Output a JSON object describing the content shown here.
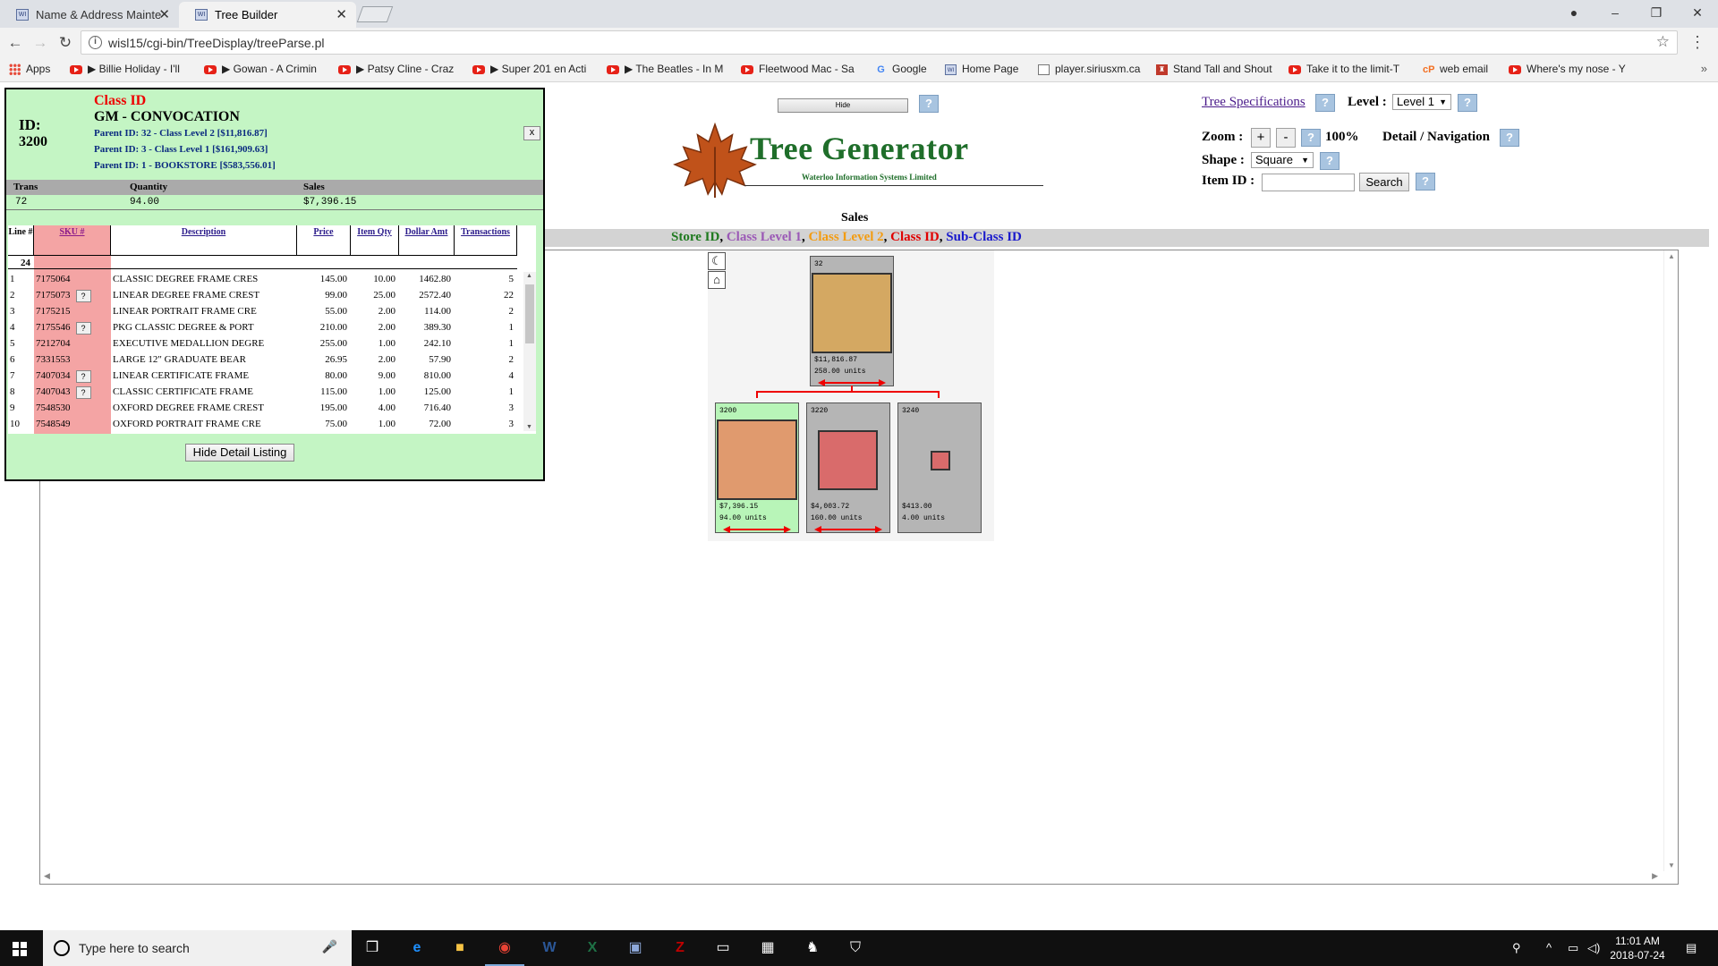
{
  "browser": {
    "tabs": [
      {
        "label": "Name & Address Mainte",
        "active": false
      },
      {
        "label": "Tree Builder",
        "active": true
      }
    ],
    "url": "wisl15/cgi-bin/TreeDisplay/treeParse.pl",
    "bookmarks": [
      {
        "label": "Apps",
        "icon": "apps-grid-icon"
      },
      {
        "label": "▶ Billie Holiday - I'll",
        "icon": "youtube-icon"
      },
      {
        "label": "▶ Gowan - A Crimin",
        "icon": "youtube-icon"
      },
      {
        "label": "▶ Patsy Cline - Craz",
        "icon": "youtube-icon"
      },
      {
        "label": "▶ Super 201 en Acti",
        "icon": "youtube-icon"
      },
      {
        "label": "▶ The Beatles - In M",
        "icon": "youtube-icon"
      },
      {
        "label": "Fleetwood Mac - Sa",
        "icon": "youtube-icon"
      },
      {
        "label": "Google",
        "icon": "google-icon"
      },
      {
        "label": "Home Page",
        "icon": "wisl-icon"
      },
      {
        "label": "player.siriusxm.ca",
        "icon": "page-icon"
      },
      {
        "label": "Stand Tall and Shout",
        "icon": "bookmark-icon"
      },
      {
        "label": "Take it to the limit-T",
        "icon": "youtube-icon"
      },
      {
        "label": "web email",
        "icon": "cpanel-icon"
      },
      {
        "label": "Where's my nose - Y",
        "icon": "youtube-icon"
      }
    ],
    "more": "»"
  },
  "controls": {
    "hide_label": "Hide",
    "help_label": "?",
    "tree_spec_link": "Tree Specifications",
    "level_label": "Level :",
    "level_value": "Level 1",
    "zoom_label": "Zoom :",
    "zoom_plus": "+",
    "zoom_minus": "-",
    "zoom_value": "100%",
    "detail_nav_label": "Detail / Navigation",
    "shape_label": "Shape :",
    "shape_value": "Square",
    "item_id_label": "Item ID :",
    "item_id_value": "",
    "search_label": "Search"
  },
  "logo": {
    "title": "Tree Generator",
    "subtitle": "Waterloo Information Systems Limited"
  },
  "sales_label": "Sales",
  "legend": [
    {
      "text": "Store ID",
      "color": "#1f7a1f"
    },
    {
      "text": ", ",
      "color": "#000000"
    },
    {
      "text": "Class Level 1",
      "color": "#9b59b6"
    },
    {
      "text": ", ",
      "color": "#000000"
    },
    {
      "text": "Class Level 2",
      "color": "#f39c12"
    },
    {
      "text": ", ",
      "color": "#000000"
    },
    {
      "text": "Class ID",
      "color": "#e00000"
    },
    {
      "text": ", ",
      "color": "#000000"
    },
    {
      "text": "Sub-Class ID",
      "color": "#1a1acc"
    }
  ],
  "tree": {
    "tools": [
      "☾",
      "⌂"
    ],
    "root": {
      "id": "32",
      "amount": "$11,816.87",
      "units": "258.00 units",
      "fill": "#d4a862",
      "relative_size": 1.0
    },
    "children": [
      {
        "id": "3200",
        "amount": "$7,396.15",
        "units": "94.00 units",
        "fill": "#e09a6e",
        "relative_size": 1.0,
        "selected": true
      },
      {
        "id": "3220",
        "amount": "$4,003.72",
        "units": "160.00 units",
        "fill": "#d96b6b",
        "relative_size": 0.74,
        "selected": false
      },
      {
        "id": "3240",
        "amount": "$413.00",
        "units": "4.00 units",
        "fill": "#d96b6b",
        "relative_size": 0.24,
        "selected": false
      }
    ]
  },
  "detail": {
    "id_label": "ID:",
    "id_value": "3200",
    "class_label": "Class ID",
    "class_name": "GM - CONVOCATION",
    "parents": [
      "Parent ID: 32 - Class Level 2 [$11,816.87]",
      "Parent ID: 3 - Class Level 1 [$161,909.63]",
      "Parent ID: 1 - BOOKSTORE [$583,556.01]"
    ],
    "close_label": "x",
    "summary_headers": [
      "Trans",
      "Quantity",
      "Sales"
    ],
    "summary_values": [
      "72",
      "94.00",
      "$7,396.15"
    ],
    "columns": [
      "Line #",
      "SKU #",
      "Description",
      "Price",
      "Item Qty",
      "Dollar Amt",
      "Transactions"
    ],
    "line_count": "24",
    "rows": [
      {
        "line": "1",
        "sku": "7175064",
        "q": false,
        "desc": "CLASSIC DEGREE FRAME CRES",
        "price": "145.00",
        "qty": "10.00",
        "amt": "1462.80",
        "trans": "5"
      },
      {
        "line": "2",
        "sku": "7175073",
        "q": true,
        "desc": "LINEAR DEGREE FRAME CREST",
        "price": "99.00",
        "qty": "25.00",
        "amt": "2572.40",
        "trans": "22"
      },
      {
        "line": "3",
        "sku": "7175215",
        "q": false,
        "desc": "LINEAR PORTRAIT FRAME CRE",
        "price": "55.00",
        "qty": "2.00",
        "amt": "114.00",
        "trans": "2"
      },
      {
        "line": "4",
        "sku": "7175546",
        "q": true,
        "desc": "PKG CLASSIC DEGREE & PORT",
        "price": "210.00",
        "qty": "2.00",
        "amt": "389.30",
        "trans": "1"
      },
      {
        "line": "5",
        "sku": "7212704",
        "q": false,
        "desc": "EXECUTIVE MEDALLION DEGRE",
        "price": "255.00",
        "qty": "1.00",
        "amt": "242.10",
        "trans": "1"
      },
      {
        "line": "6",
        "sku": "7331553",
        "q": false,
        "desc": "LARGE 12\" GRADUATE BEAR",
        "price": "26.95",
        "qty": "2.00",
        "amt": "57.90",
        "trans": "2"
      },
      {
        "line": "7",
        "sku": "7407034",
        "q": true,
        "desc": "LINEAR CERTIFICATE FRAME",
        "price": "80.00",
        "qty": "9.00",
        "amt": "810.00",
        "trans": "4"
      },
      {
        "line": "8",
        "sku": "7407043",
        "q": true,
        "desc": "CLASSIC CERTIFICATE FRAME",
        "price": "115.00",
        "qty": "1.00",
        "amt": "125.00",
        "trans": "1"
      },
      {
        "line": "9",
        "sku": "7548530",
        "q": false,
        "desc": "OXFORD DEGREE FRAME CREST",
        "price": "195.00",
        "qty": "4.00",
        "amt": "716.40",
        "trans": "3"
      },
      {
        "line": "10",
        "sku": "7548549",
        "q": false,
        "desc": "OXFORD PORTRAIT FRAME CRE",
        "price": "75.00",
        "qty": "1.00",
        "amt": "72.00",
        "trans": "3"
      }
    ],
    "hide_detail_label": "Hide Detail Listing"
  },
  "taskbar": {
    "search_placeholder": "Type here to search",
    "time": "11:01 AM",
    "date": "2018-07-24"
  }
}
